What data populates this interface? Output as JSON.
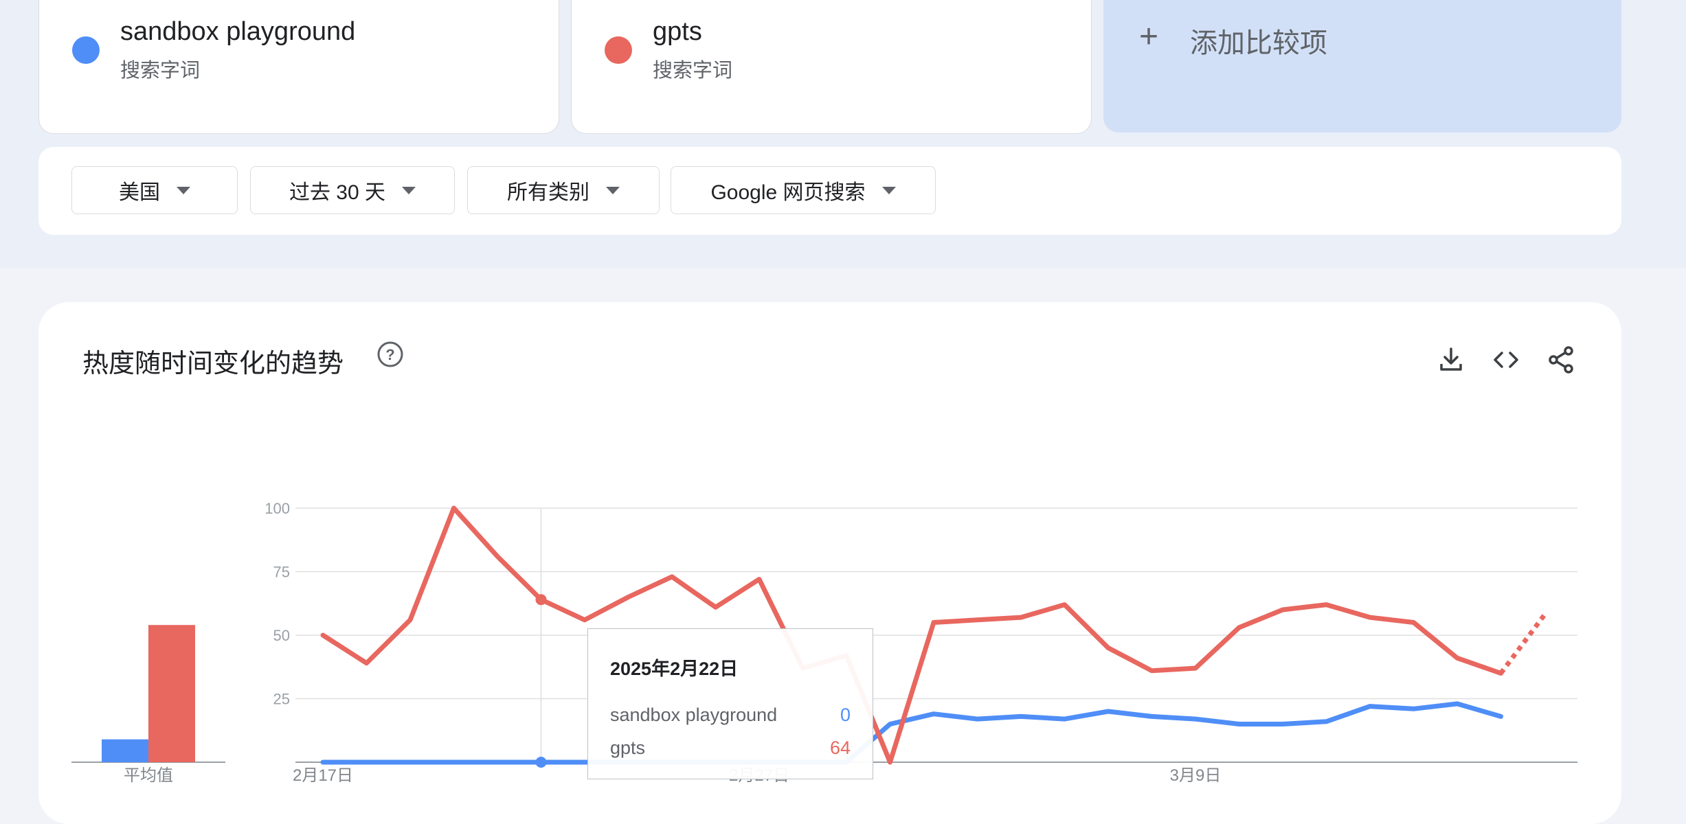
{
  "terms": [
    {
      "name": "sandbox playground",
      "sub": "搜索字词",
      "color": "#4f8ef7"
    },
    {
      "name": "gpts",
      "sub": "搜索字词",
      "color": "#e8675f"
    }
  ],
  "add_compare": {
    "plus": "+",
    "label": "添加比较项"
  },
  "filters": [
    {
      "label": "美国"
    },
    {
      "label": "过去 30 天"
    },
    {
      "label": "所有类别"
    },
    {
      "label": "Google 网页搜索"
    }
  ],
  "chart": {
    "title": "热度随时间变化的趋势",
    "icons": [
      "help-icon",
      "download-icon",
      "embed-icon",
      "share-icon"
    ],
    "average_label": "平均值"
  },
  "tooltip": {
    "date": "2025年2月22日",
    "rows": [
      {
        "name": "sandbox playground",
        "value": "0",
        "color": "#4f8ef7"
      },
      {
        "name": "gpts",
        "value": "64",
        "color": "#e8675f"
      }
    ]
  },
  "chart_data": {
    "type": "line",
    "x": [
      "2月17日",
      "2月18日",
      "2月19日",
      "2月20日",
      "2月21日",
      "2月22日",
      "2月23日",
      "2月24日",
      "2月25日",
      "2月26日",
      "2月27日",
      "2月28日",
      "3月1日",
      "3月2日",
      "3月3日",
      "3月4日",
      "3月5日",
      "3月6日",
      "3月7日",
      "3月8日",
      "3月9日",
      "3月10日",
      "3月11日",
      "3月12日",
      "3月13日",
      "3月14日",
      "3月15日",
      "3月16日",
      "3月17日",
      "3月18日"
    ],
    "x_tick_labels": [
      "2月17日",
      "2月27日",
      "3月9日"
    ],
    "y_ticks": [
      25,
      50,
      75,
      100
    ],
    "ylim": [
      0,
      100
    ],
    "grid": true,
    "series": [
      {
        "name": "sandbox playground",
        "color": "#4f8ef7",
        "values": [
          0,
          0,
          0,
          0,
          0,
          0,
          0,
          0,
          0,
          0,
          0,
          0,
          0,
          15,
          19,
          17,
          18,
          17,
          20,
          18,
          17,
          15,
          15,
          16,
          22,
          21,
          23,
          18,
          null,
          null
        ]
      },
      {
        "name": "gpts",
        "color": "#e8675f",
        "values": [
          50,
          39,
          56,
          100,
          81,
          64,
          56,
          65,
          73,
          61,
          72,
          37,
          42,
          0,
          55,
          56,
          57,
          62,
          45,
          36,
          37,
          53,
          60,
          62,
          57,
          55,
          41,
          35,
          58,
          null
        ],
        "partial_from_index": 27
      }
    ],
    "averages": [
      {
        "name": "sandbox playground",
        "value": 9,
        "color": "#4f8ef7"
      },
      {
        "name": "gpts",
        "value": 54,
        "color": "#e8675f"
      }
    ],
    "highlight_index": 5
  }
}
